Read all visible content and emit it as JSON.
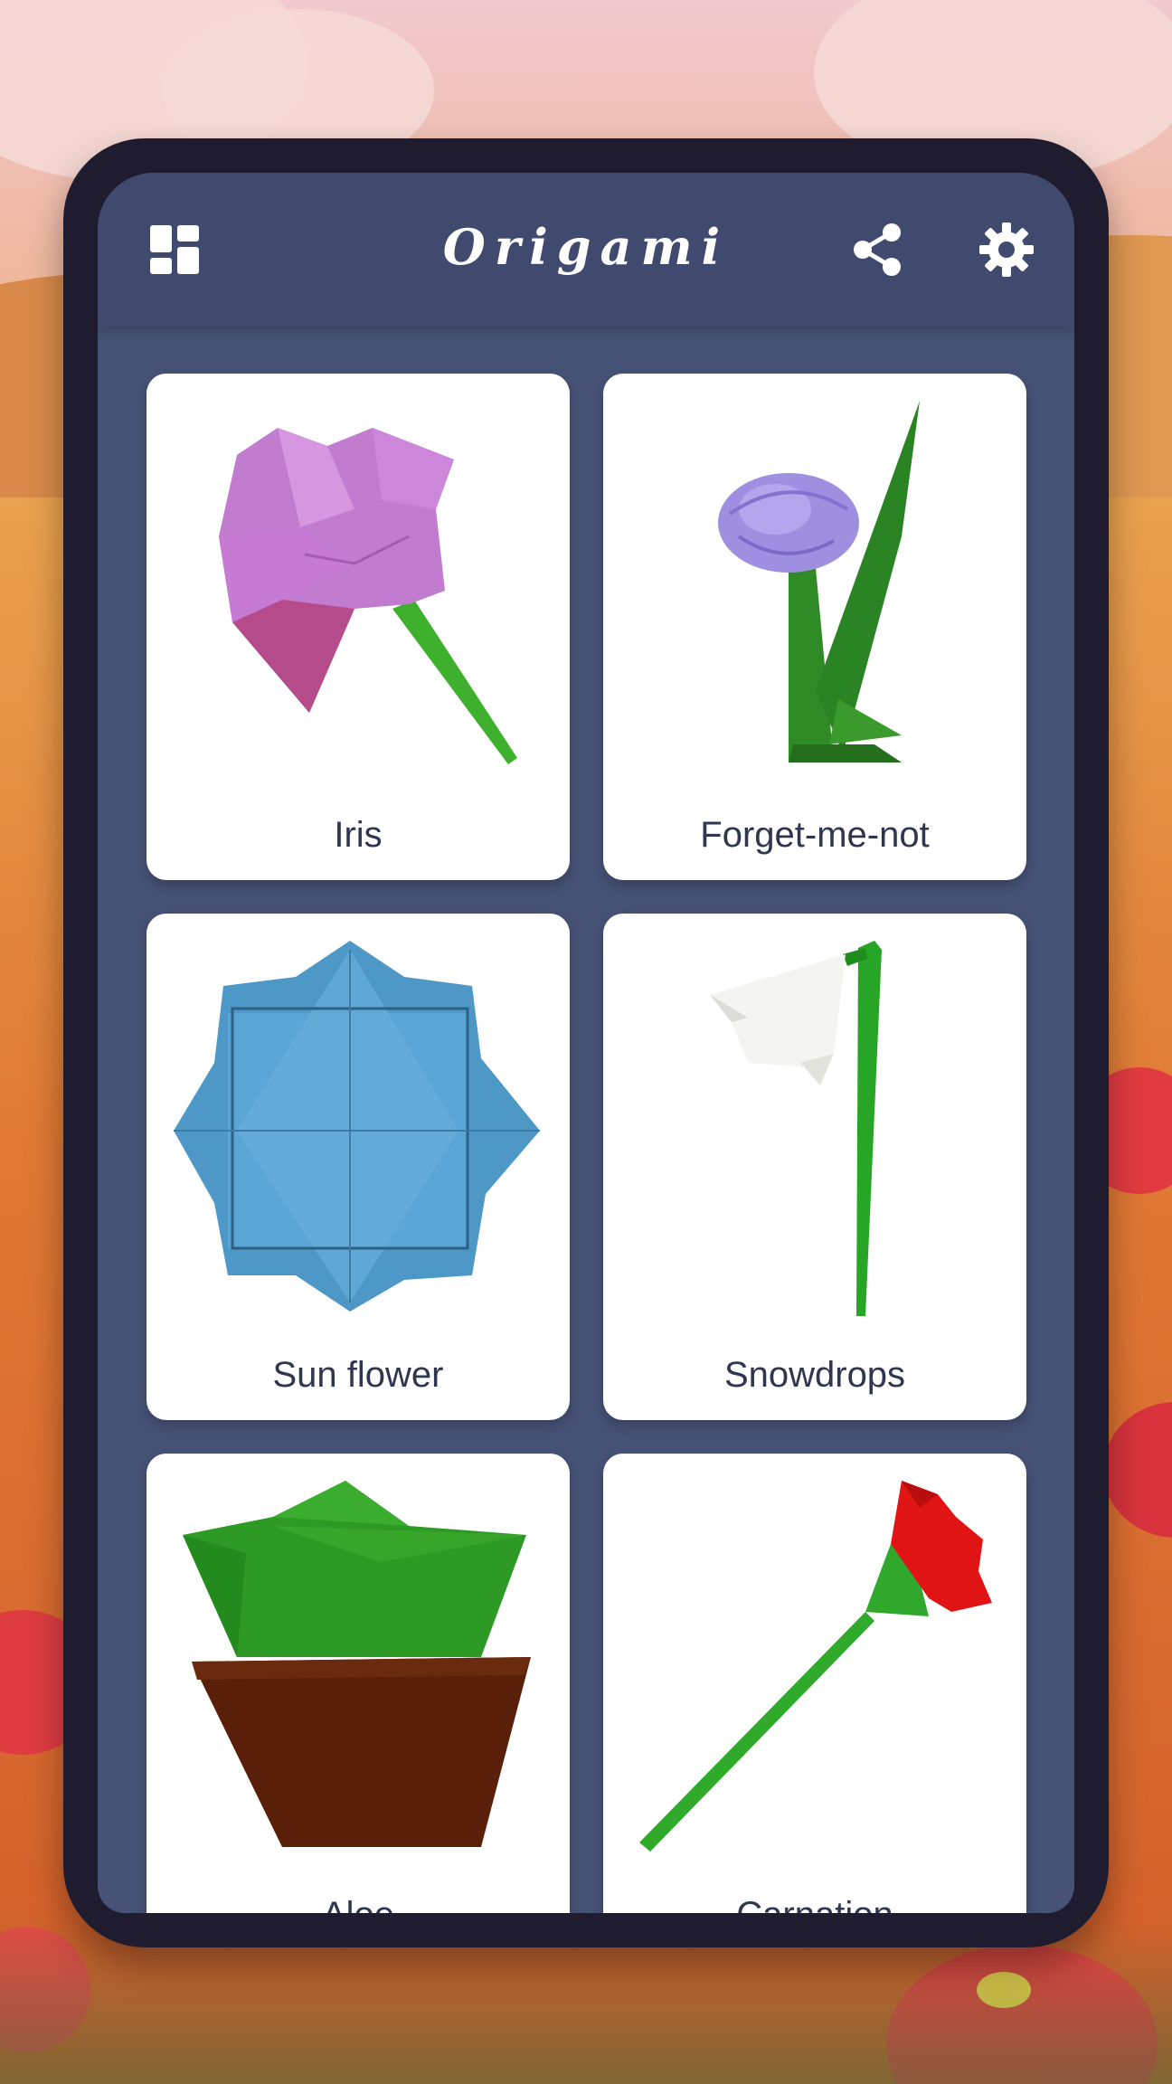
{
  "app": {
    "title": "Origami"
  },
  "toolbar": {
    "menu_icon": "dashboard-grid-icon",
    "share_icon": "share-icon",
    "settings_icon": "gear-icon"
  },
  "colors": {
    "appbar": "#3f4a6e",
    "screen": "#465276",
    "card": "#ffffff",
    "label_text": "#2f3650"
  },
  "cards": [
    {
      "label": "Iris",
      "image": "purple-origami-iris"
    },
    {
      "label": "Forget-me-not",
      "image": "lilac-origami-forget-me-not"
    },
    {
      "label": "Sun flower",
      "image": "blue-origami-octagonal-flower"
    },
    {
      "label": "Snowdrops",
      "image": "white-origami-snowdrop"
    },
    {
      "label": "Aloe",
      "image": "green-origami-plant-in-brown-pot"
    },
    {
      "label": "Carnation",
      "image": "red-origami-carnation"
    }
  ]
}
